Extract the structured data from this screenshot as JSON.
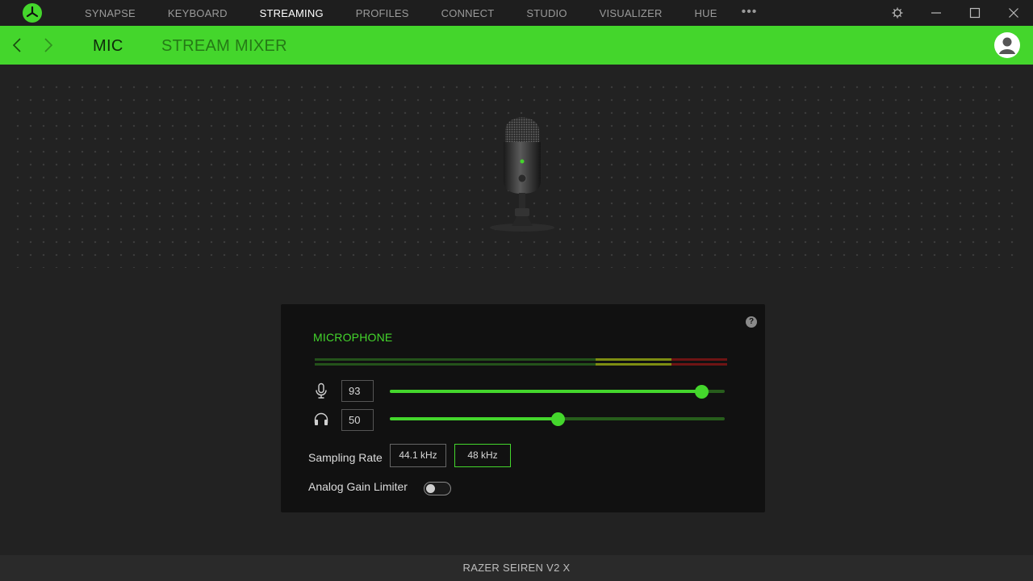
{
  "colors": {
    "accent": "#44d62c",
    "background": "#222222",
    "panel": "#111111",
    "meter_yellow": "#7d8d12",
    "meter_red": "#6e1414"
  },
  "nav": {
    "items": [
      "SYNAPSE",
      "KEYBOARD",
      "STREAMING",
      "PROFILES",
      "CONNECT",
      "STUDIO",
      "VISUALIZER",
      "HUE"
    ],
    "active": "STREAMING",
    "more": "•••"
  },
  "subnav": {
    "tabs": [
      "MIC",
      "STREAM MIXER"
    ],
    "active": "MIC"
  },
  "icons": {
    "logo": "razer-logo-icon",
    "settings": "gear-icon",
    "minimize": "minimize-icon",
    "maximize": "maximize-icon",
    "close": "close-icon",
    "back": "chevron-left-icon",
    "forward": "chevron-right-icon",
    "profile": "user-avatar-icon",
    "mic": "microphone-icon",
    "headphones": "headphones-icon",
    "help": "help-icon"
  },
  "panel": {
    "title": "MICROPHONE",
    "help": "?",
    "mic_gain": {
      "value": "93",
      "level": 0.93
    },
    "monitor": {
      "value": "50",
      "level": 0.5
    },
    "sampling_rate": {
      "label": "Sampling Rate",
      "options": [
        "44.1 kHz",
        "48 kHz"
      ],
      "selected": "48 kHz"
    },
    "analog_gain_limiter": {
      "label": "Analog Gain Limiter",
      "enabled": false
    }
  },
  "footer": {
    "device_name": "RAZER SEIREN V2 X"
  }
}
